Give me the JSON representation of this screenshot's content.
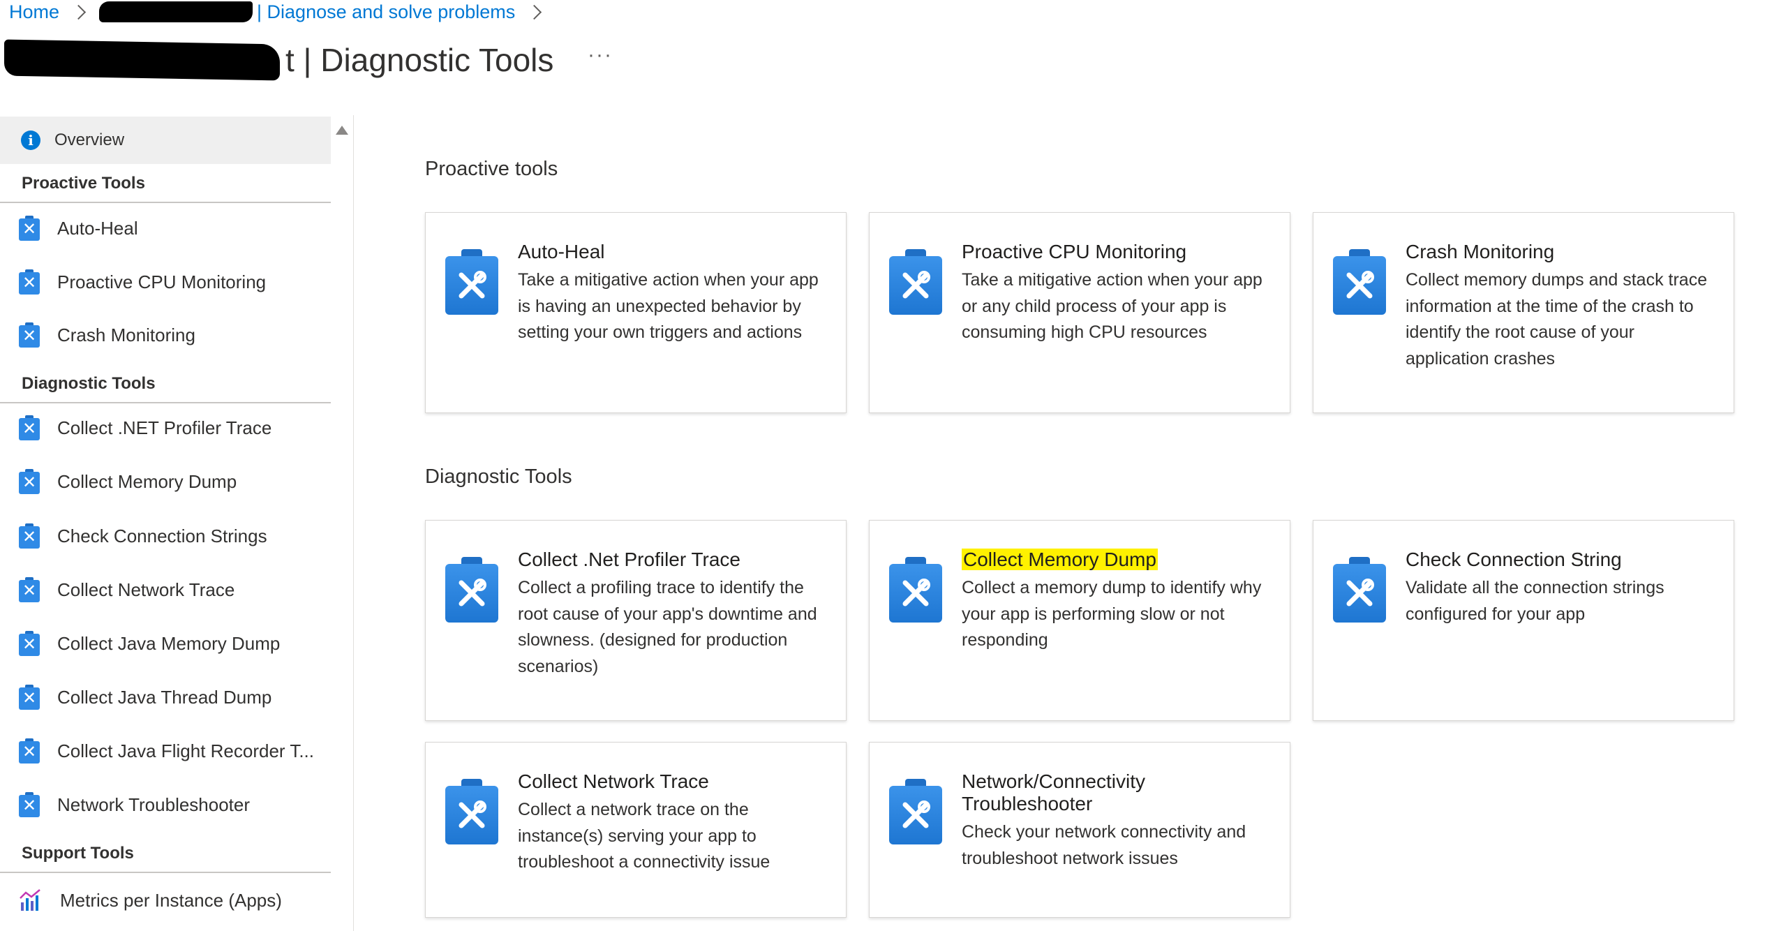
{
  "header": {
    "breadcrumb": [
      {
        "label": "Home"
      },
      {
        "label": "| Diagnose and solve problems"
      }
    ],
    "title": "t | Diagnostic Tools",
    "more_label": "···"
  },
  "sidebar": {
    "overview": "Overview",
    "sections": [
      {
        "title": "Proactive Tools",
        "items": [
          "Auto-Heal",
          "Proactive CPU Monitoring",
          "Crash Monitoring"
        ]
      },
      {
        "title": "Diagnostic Tools",
        "items": [
          "Collect .NET Profiler Trace",
          "Collect Memory Dump",
          "Check Connection Strings",
          "Collect Network Trace",
          "Collect Java Memory Dump",
          "Collect Java Thread Dump",
          "Collect Java Flight Recorder T...",
          "Network Troubleshooter"
        ]
      },
      {
        "title": "Support Tools",
        "items": [
          "Metrics per Instance (Apps)"
        ]
      }
    ]
  },
  "main": {
    "proactive": {
      "title": "Proactive tools",
      "cards": [
        {
          "title": "Auto-Heal",
          "desc": "Take a mitigative action when your app is having an unexpected behavior by setting your own triggers and actions"
        },
        {
          "title": "Proactive CPU Monitoring",
          "desc": "Take a mitigative action when your app or any child process of your app is consuming high CPU resources"
        },
        {
          "title": "Crash Monitoring",
          "desc": "Collect memory dumps and stack trace information at the time of the crash to identify the root cause of your application crashes"
        }
      ]
    },
    "diagnostic": {
      "title": "Diagnostic Tools",
      "cards": [
        {
          "title": "Collect .Net Profiler Trace",
          "desc": "Collect a profiling trace to identify the root cause of your app's downtime and slowness. (designed for production scenarios)"
        },
        {
          "title": "Collect Memory Dump",
          "desc": "Collect a memory dump to identify why your app is performing slow or not responding",
          "highlighted": true
        },
        {
          "title": "Check Connection String",
          "desc": "Validate all the connection strings configured for your app"
        },
        {
          "title": "Collect Network Trace",
          "desc": "Collect a network trace on the instance(s) serving your app to troubleshoot a connectivity issue"
        },
        {
          "title": "Network/Connectivity Troubleshooter",
          "desc": "Check your network connectivity and troubleshoot network issues"
        }
      ]
    }
  },
  "colors": {
    "accent": "#0078d4",
    "icon_blue": "#2f8ae6",
    "highlight": "#fff100"
  },
  "icons": {
    "tool": "clipboard-wrench-icon",
    "info": "info-icon",
    "metrics": "metrics-chart-icon"
  }
}
